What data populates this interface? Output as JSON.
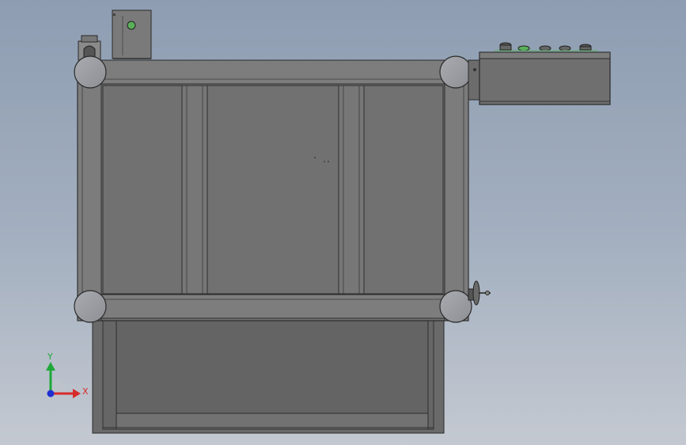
{
  "view": {
    "background_top": "#8e9db2",
    "background_bottom": "#c4c9d1"
  },
  "model": {
    "panel_fill": "#717171",
    "lower_panel_fill": "#676767",
    "frame_fill": "#7c7c7c",
    "edge_color": "#2a2a2a",
    "corner_fill": "#999ba0",
    "control_box_fill": "#6f6f6f",
    "button_accent": "#5ab05a"
  },
  "triad": {
    "x_label": "X",
    "y_label": "Y",
    "x_color": "#d62a2a",
    "y_color": "#1fa83a",
    "origin_color": "#1f2fd0"
  }
}
